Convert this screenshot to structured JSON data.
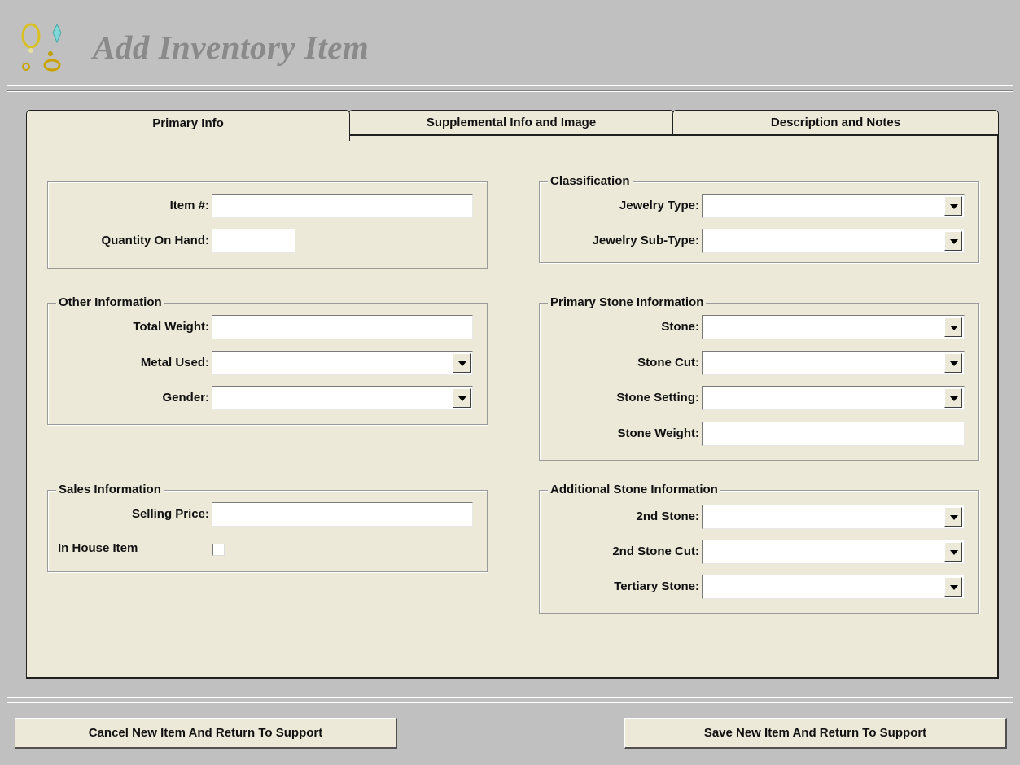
{
  "window": {
    "title": "Add Inventory Item"
  },
  "tabs": [
    {
      "label": "Primary Info",
      "active": true
    },
    {
      "label": "Supplemental Info and Image",
      "active": false
    },
    {
      "label": "Description and Notes",
      "active": false
    }
  ],
  "basic": {
    "item_label": "Item #:",
    "item_value": "",
    "qty_label": "Quantity On Hand:",
    "qty_value": ""
  },
  "other": {
    "legend": "Other Information",
    "weight_label": "Total Weight:",
    "weight_value": "",
    "metal_label": "Metal Used:",
    "metal_value": "",
    "gender_label": "Gender:",
    "gender_value": ""
  },
  "sales": {
    "legend": "Sales Information",
    "price_label": "Selling Price:",
    "price_value": "",
    "inhouse_label": "In House Item",
    "inhouse_checked": false
  },
  "classification": {
    "legend": "Classification",
    "type_label": "Jewelry Type:",
    "type_value": "",
    "subtype_label": "Jewelry Sub-Type:",
    "subtype_value": ""
  },
  "primary_stone": {
    "legend": "Primary Stone Information",
    "stone_label": "Stone:",
    "stone_value": "",
    "cut_label": "Stone Cut:",
    "cut_value": "",
    "setting_label": "Stone Setting:",
    "setting_value": "",
    "weight_label": "Stone Weight:",
    "weight_value": ""
  },
  "additional_stone": {
    "legend": "Additional Stone Information",
    "second_label": "2nd Stone:",
    "second_value": "",
    "second_cut_label": "2nd Stone Cut:",
    "second_cut_value": "",
    "tertiary_label": "Tertiary Stone:",
    "tertiary_value": ""
  },
  "footer": {
    "cancel_label": "Cancel New Item And Return To Support",
    "save_label": "Save New Item And Return To Support"
  },
  "icons": {
    "logo": "jewelry-logo-icon",
    "dropdown": "chevron-down-icon"
  },
  "colors": {
    "window_bg": "#c0c0c0",
    "panel_bg": "#ece9d8",
    "title_text": "#8a8a8a"
  }
}
